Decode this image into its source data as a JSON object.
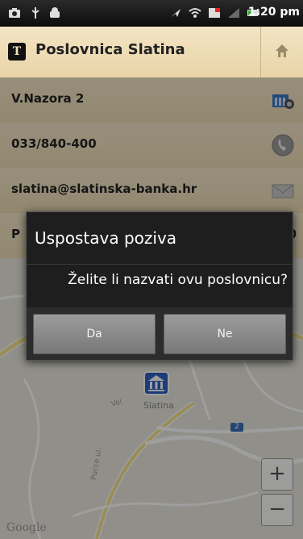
{
  "status_bar": {
    "time": "1:20 pm",
    "icons": [
      "screenshot-icon",
      "usb-icon",
      "android-debug-icon",
      "gps-icon",
      "wifi-icon",
      "notification-icon",
      "signal-icon",
      "battery-icon"
    ]
  },
  "header": {
    "app_icon_letter": "T",
    "title": "Poslovnica Slatina",
    "home_icon": "home-icon"
  },
  "details": [
    {
      "text": "V.Nazora 2",
      "icon": "bank-building-icon"
    },
    {
      "text": "033/840-400",
      "icon": "phone-icon"
    },
    {
      "text": "slatina@slatinska-banka.hr",
      "icon": "envelope-icon"
    },
    {
      "text": "P",
      "tail": "0"
    }
  ],
  "map": {
    "place_label": "Slatina",
    "road_label_1": "Pucce ul.",
    "road_label_2": "Vel",
    "route_badge": "2",
    "zoom_in": "+",
    "zoom_out": "−",
    "logo": "Google"
  },
  "dialog": {
    "title": "Uspostava poziva",
    "message": "Želite li nazvati ovu poslovnicu?",
    "confirm_label": "Da",
    "cancel_label": "Ne"
  }
}
